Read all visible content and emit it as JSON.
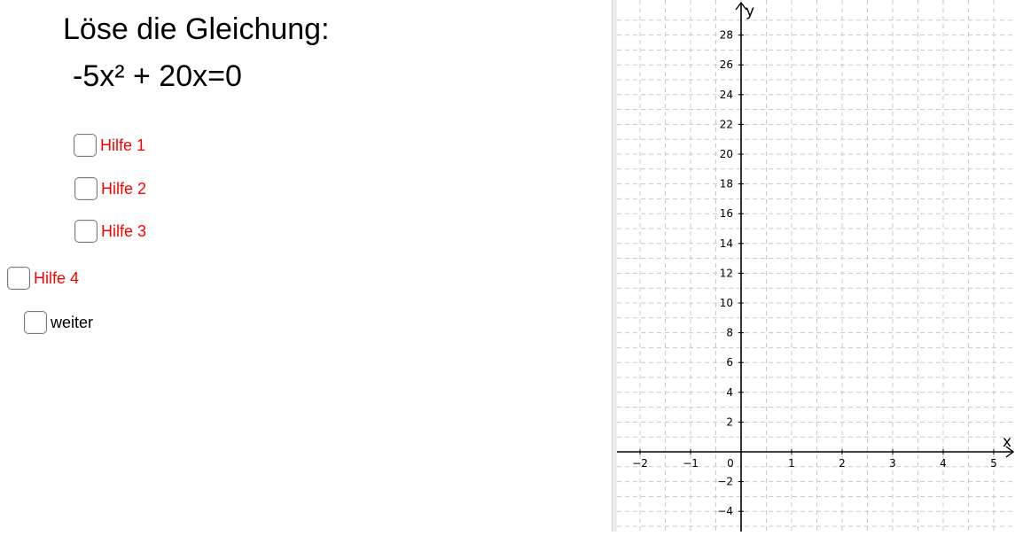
{
  "task": {
    "title": "Löse die Gleichung:",
    "equation": "-5x² + 20x=0"
  },
  "checkboxes": [
    {
      "label": "Hilfe 1",
      "checked": false,
      "color": "#ff0000"
    },
    {
      "label": "Hilfe 2",
      "checked": false,
      "color": "#ff0000"
    },
    {
      "label": "Hilfe 3",
      "checked": false,
      "color": "#ff0000"
    },
    {
      "label": "Hilfe 4",
      "checked": false,
      "color": "#ff0000"
    },
    {
      "label": "weiter",
      "checked": false,
      "color": "#000000"
    }
  ],
  "graph": {
    "x_axis_label": "x",
    "y_axis_label": "y",
    "x_ticks": [
      "−2",
      "−1",
      "0",
      "1",
      "2",
      "3",
      "4",
      "5"
    ],
    "y_ticks_positive": [
      "2",
      "4",
      "6",
      "8",
      "10",
      "12",
      "14",
      "16",
      "18",
      "20",
      "22",
      "24",
      "26",
      "28"
    ],
    "y_ticks_negative": [
      "−2",
      "−4"
    ],
    "x_range": [
      -2.3,
      5.3
    ],
    "y_range": [
      -5.3,
      29.8
    ],
    "grid": true,
    "grid_color": "#c8c8c8"
  }
}
